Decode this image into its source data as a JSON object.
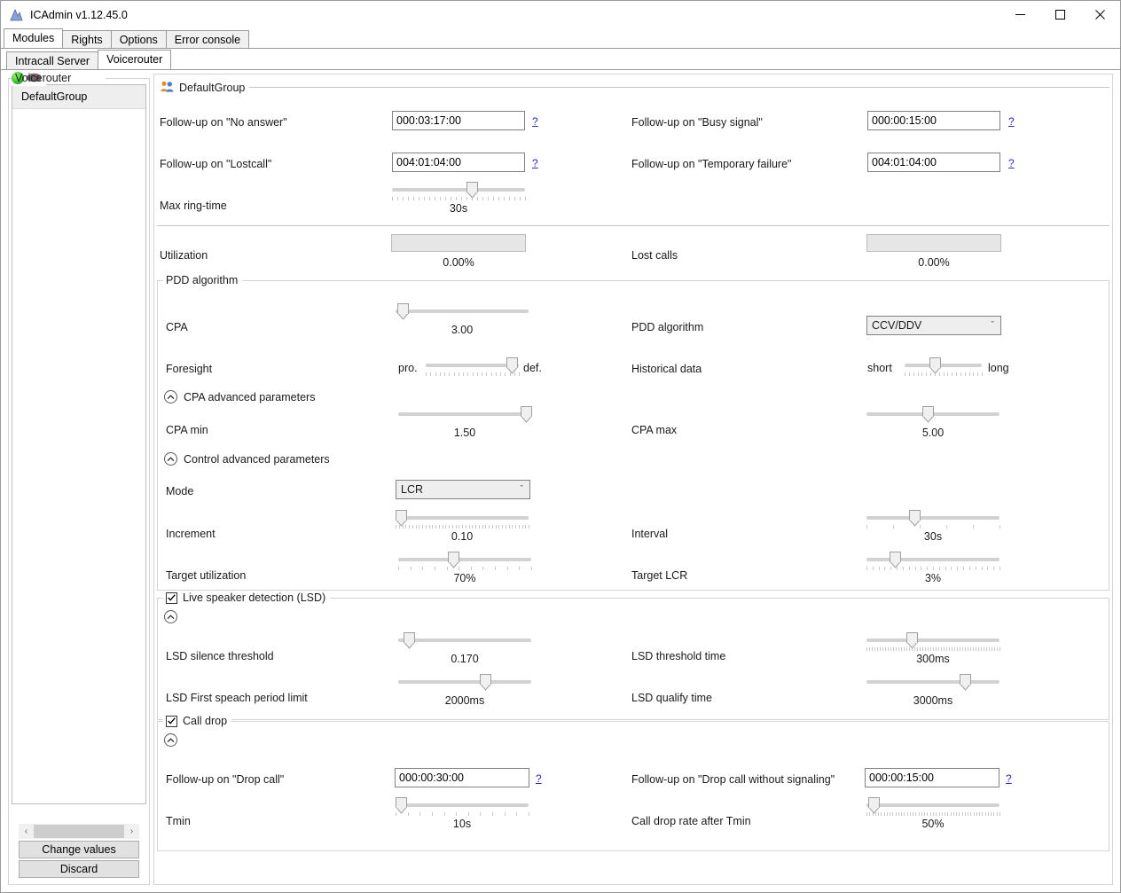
{
  "window": {
    "title": "ICAdmin v1.12.45.0",
    "app_icon": "app-icon",
    "minimize": "─",
    "maximize": "□",
    "close": "✕"
  },
  "tabs_primary": [
    {
      "label": "Modules",
      "active": true
    },
    {
      "label": "Rights",
      "active": false
    },
    {
      "label": "Options",
      "active": false
    },
    {
      "label": "Error console",
      "active": false
    }
  ],
  "tabs_secondary": [
    {
      "label": "Intracall Server",
      "active": false
    },
    {
      "label": "Voicerouter",
      "active": true
    }
  ],
  "left_panel": {
    "legend": "Voicerouter",
    "status_color": "#2fbf2f",
    "groups": [
      {
        "label": "DefaultGroup",
        "selected": true
      }
    ],
    "scroll_left": "‹",
    "scroll_right": "›",
    "buttons": {
      "change_values": "Change values",
      "discard": "Discard"
    }
  },
  "main": {
    "group_legend": "DefaultGroup",
    "section_general": {
      "no_answer": {
        "label": "Follow-up on \"No answer\"",
        "value": "000:03:17:00",
        "help": "?"
      },
      "busy_signal": {
        "label": "Follow-up on \"Busy signal\"",
        "value": "000:00:15:00",
        "help": "?"
      },
      "lostcall": {
        "label": "Follow-up on \"Lostcall\"",
        "value": "004:01:04:00",
        "help": "?"
      },
      "temp_failure": {
        "label": "Follow-up on \"Temporary failure\"",
        "value": "004:01:04:00",
        "help": "?"
      },
      "max_ring_time": {
        "label": "Max ring-time",
        "value": "30s",
        "pos": 60
      }
    },
    "section_stats": {
      "utilization": {
        "label": "Utilization",
        "value": "0.00%",
        "percent": 0
      },
      "lost_calls": {
        "label": "Lost calls",
        "value": "0.00%",
        "percent": 0
      }
    },
    "section_pdd": {
      "legend": "PDD algorithm",
      "cpa": {
        "label": "CPA",
        "value": "3.00",
        "pos": 5
      },
      "pdd_algorithm": {
        "label": "PDD algorithm",
        "value": "CCV/DDV",
        "chevron": "ˇ"
      },
      "foresight": {
        "label": "Foresight",
        "left": "pro.",
        "right": "def.",
        "pos": 92
      },
      "historical_data": {
        "label": "Historical data",
        "left": "short",
        "right": "long",
        "pos": 39
      },
      "cpa_advanced": {
        "label": "CPA advanced parameters",
        "chevron": "˄"
      },
      "cpa_min": {
        "label": "CPA min",
        "value": "1.50",
        "pos": 96
      },
      "cpa_max": {
        "label": "CPA max",
        "value": "5.00",
        "pos": 46
      },
      "control_advanced": {
        "label": "Control advanced parameters",
        "chevron": "˄"
      },
      "mode": {
        "label": "Mode",
        "value": "LCR",
        "chevron": "ˇ"
      },
      "increment": {
        "label": "Increment",
        "value": "0.10",
        "pos": 4
      },
      "interval": {
        "label": "Interval",
        "value": "30s",
        "pos": 36
      },
      "target_utilization": {
        "label": "Target utilization",
        "value": "70%",
        "pos": 41
      },
      "target_lcr": {
        "label": "Target LCR",
        "value": "3%",
        "pos": 21
      }
    },
    "section_lsd": {
      "legend": "Live speaker detection (LSD)",
      "checked": true,
      "check_glyph": "✔",
      "chevron": "˄",
      "silence_threshold": {
        "label": "LSD silence threshold",
        "value": "0.170",
        "pos": 8
      },
      "threshold_time": {
        "label": "LSD threshold time",
        "value": "300ms",
        "pos": 34
      },
      "first_speech_limit": {
        "label": "LSD First speach period limit",
        "value": "2000ms",
        "pos": 65
      },
      "qualify_time": {
        "label": "LSD qualify time",
        "value": "3000ms",
        "pos": 74
      }
    },
    "section_calldrop": {
      "legend": "Call drop",
      "checked": true,
      "check_glyph": "✔",
      "chevron": "˄",
      "drop_call": {
        "label": "Follow-up on \"Drop call\"",
        "value": "000:00:30:00",
        "help": "?"
      },
      "drop_call_nosig": {
        "label": "Follow-up on \"Drop call without signaling\"",
        "value": "000:00:15:00",
        "help": "?"
      },
      "tmin": {
        "label": "Tmin",
        "value": "10s",
        "pos": 4
      },
      "drop_rate": {
        "label": "Call drop rate after Tmin",
        "value": "50%",
        "pos": 5
      }
    }
  }
}
